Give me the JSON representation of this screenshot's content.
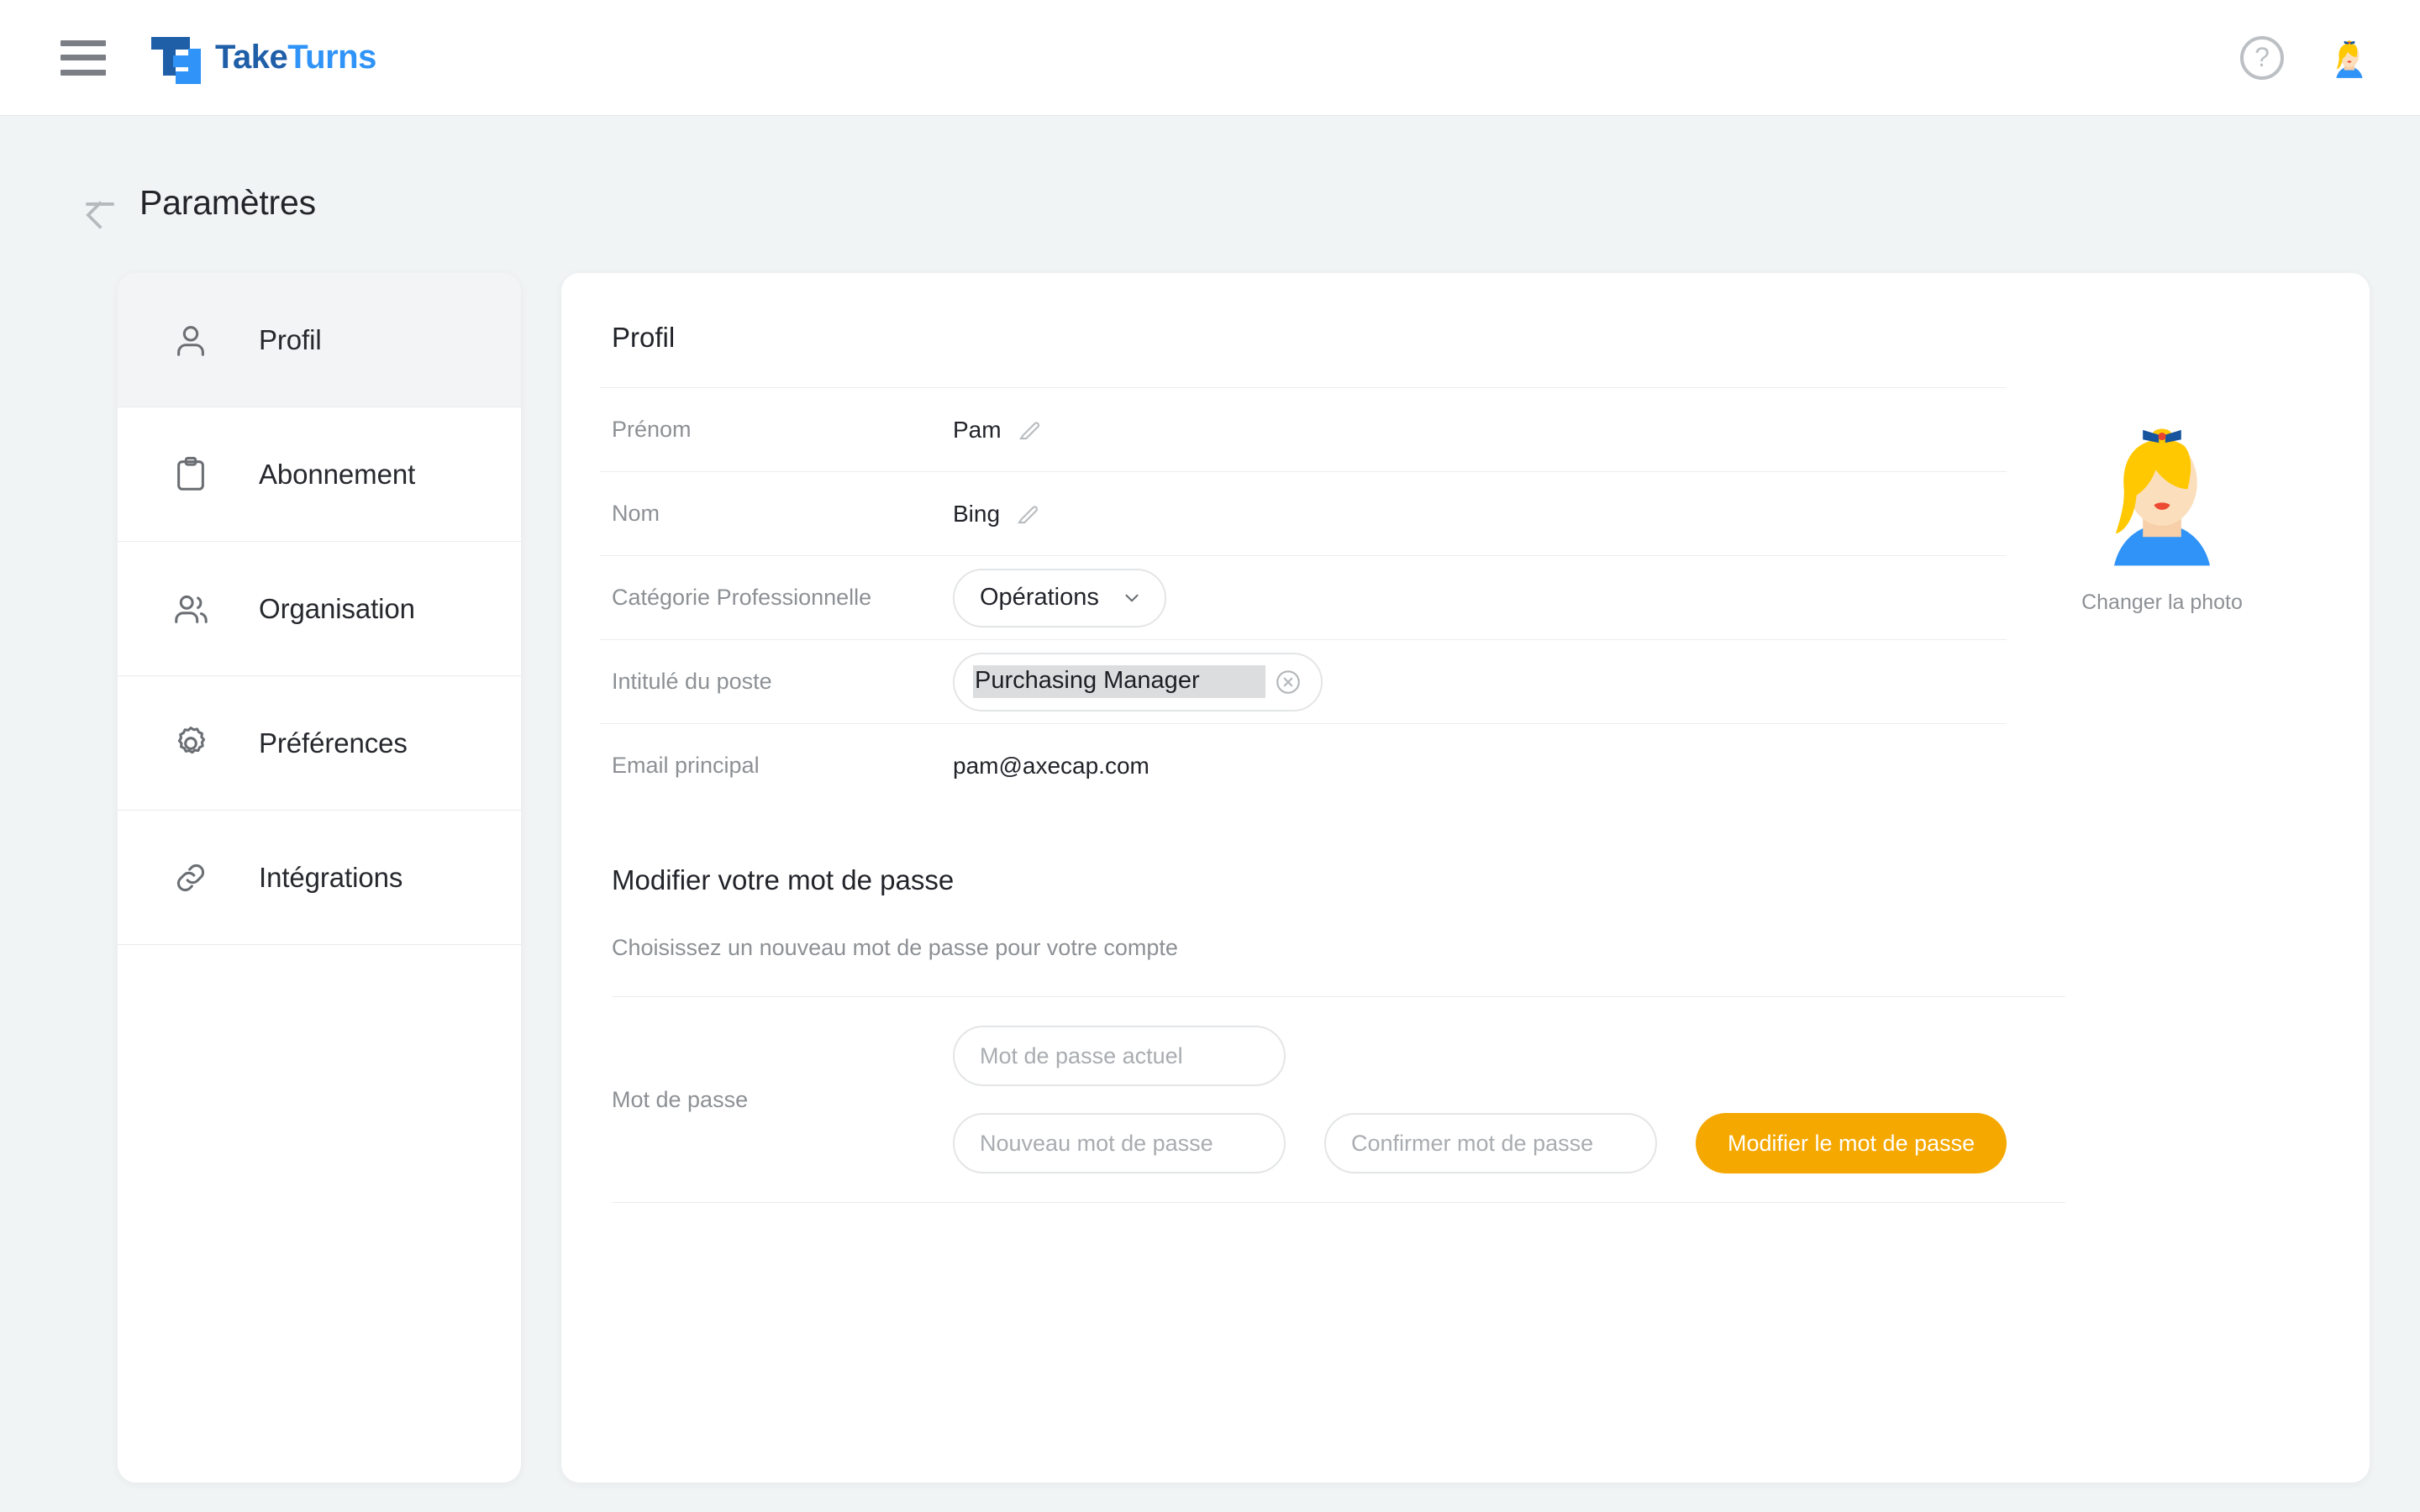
{
  "topbar": {
    "menu_icon": "hamburger-menu-icon",
    "brand_part1": "Take",
    "brand_part2": "Turns",
    "help_glyph": "?",
    "help_icon": "help-circle-icon",
    "avatar_icon": "user-avatar"
  },
  "page": {
    "back_icon": "arrow-left-icon",
    "title": "Paramètres"
  },
  "sidebar": {
    "items": [
      {
        "label": "Profil",
        "icon": "user-icon",
        "active": true
      },
      {
        "label": "Abonnement",
        "icon": "clipboard-icon",
        "active": false
      },
      {
        "label": "Organisation",
        "icon": "users-icon",
        "active": false
      },
      {
        "label": "Préférences",
        "icon": "gear-icon",
        "active": false
      },
      {
        "label": "Intégrations",
        "icon": "link-icon",
        "active": false
      }
    ]
  },
  "profile": {
    "card_title": "Profil",
    "labels": {
      "first_name": "Prénom",
      "last_name": "Nom",
      "category": "Catégorie Professionnelle",
      "job_title": "Intitulé du poste",
      "email": "Email principal"
    },
    "values": {
      "first_name": "Pam",
      "last_name": "Bing",
      "category": "Opérations",
      "job_title": "Purchasing Manager",
      "email": "pam@axecap.com"
    },
    "edit_icon": "pencil-icon",
    "chevron_icon": "chevron-down-icon",
    "clear_icon": "clear-circle-icon",
    "avatar": {
      "change_photo_label": "Changer la photo",
      "icon": "user-avatar-large"
    }
  },
  "password": {
    "title": "Modifier votre mot de passe",
    "subtitle": "Choisissez un nouveau mot de passe pour votre compte",
    "row_label": "Mot de passe",
    "current_placeholder": "Mot de passe actuel",
    "current_value": "",
    "new_placeholder": "Nouveau mot de passe",
    "new_value": "",
    "confirm_placeholder": "Confirmer mot de passe",
    "confirm_value": "",
    "submit_label": "Modifier le mot de passe"
  },
  "colors": {
    "brand_dark": "#1f5fa8",
    "brand_light": "#2f93f7",
    "accent_orange": "#f5a800",
    "page_bg": "#f1f4f5"
  }
}
